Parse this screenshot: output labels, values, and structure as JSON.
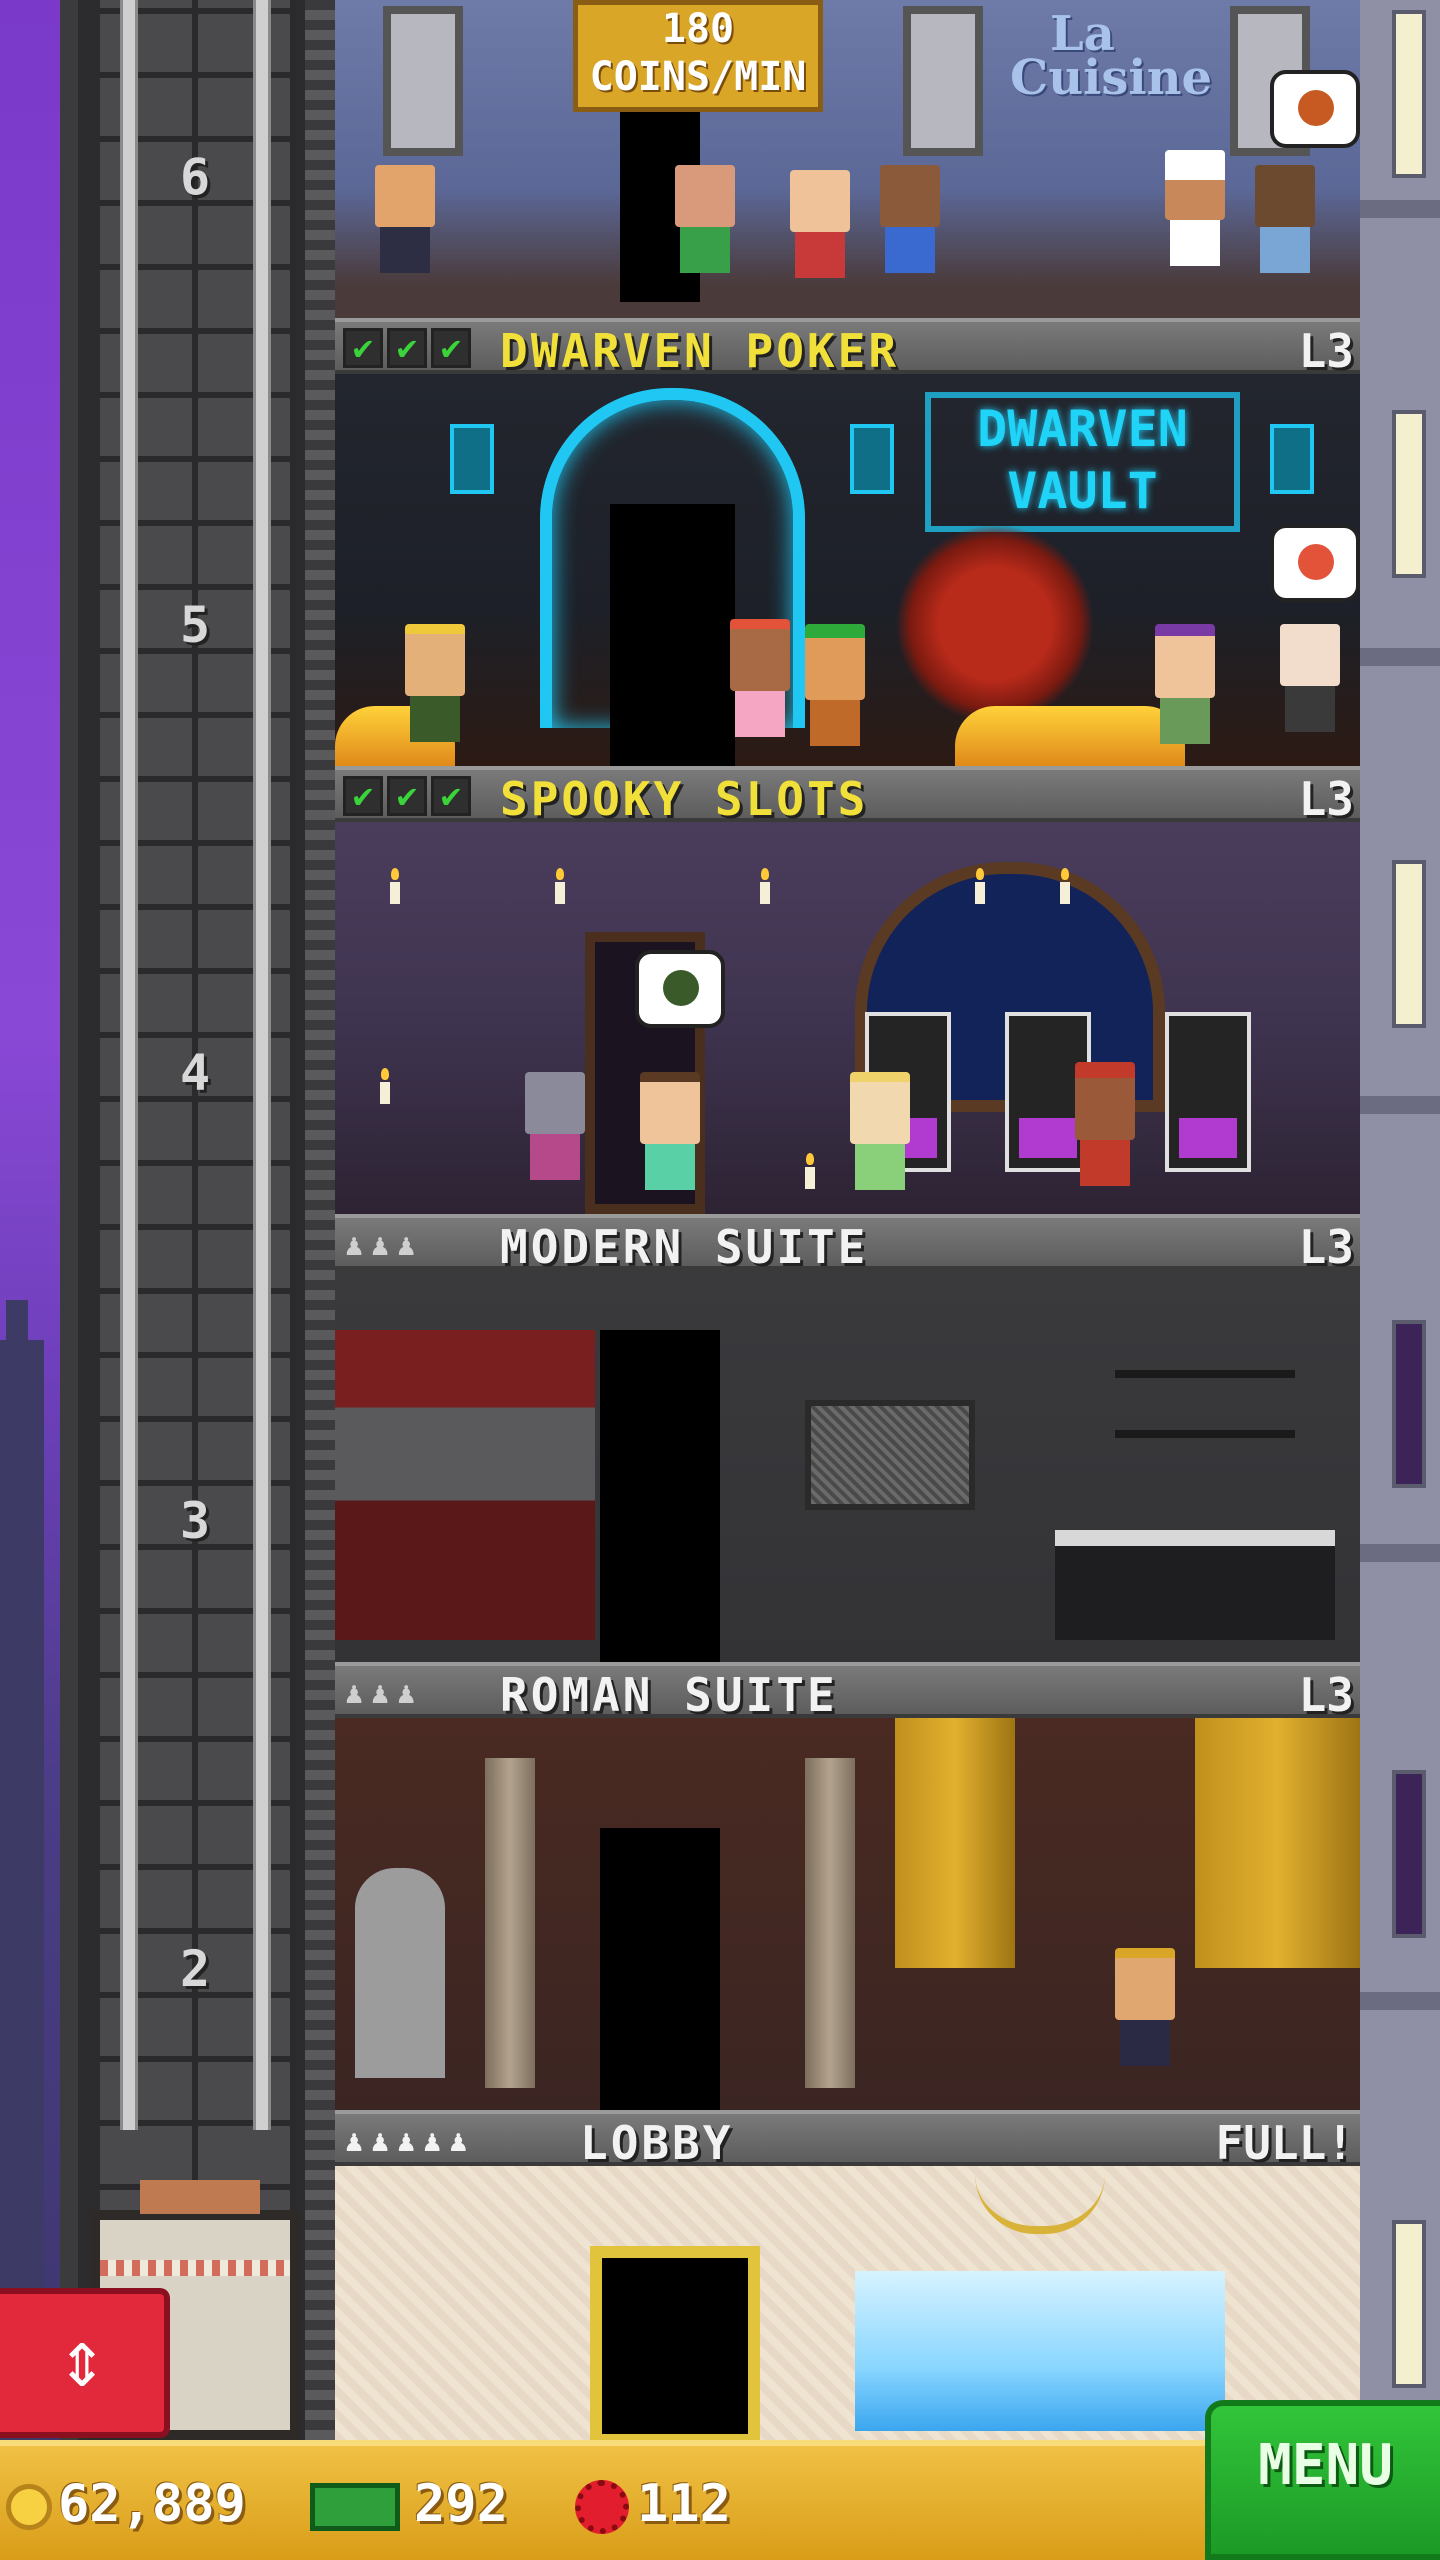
{
  "floor_numbers": [
    "6",
    "5",
    "4",
    "3",
    "2"
  ],
  "floors": {
    "restaurant": {
      "coins_rate_line1": "180",
      "coins_rate_line2": "COINS/MIN",
      "sign_line1": "La",
      "sign_line2": "Cuisine"
    },
    "dwarven_poker": {
      "name": "DWARVEN POKER",
      "level": "L3",
      "checks": [
        "✔",
        "✔",
        "✔"
      ],
      "vault_line1": "DWARVEN",
      "vault_line2": "VAULT"
    },
    "spooky_slots": {
      "name": "SPOOKY SLOTS",
      "level": "L3",
      "checks": [
        "✔",
        "✔",
        "✔"
      ]
    },
    "modern_suite": {
      "name": "MODERN SUITE",
      "level": "L3",
      "residents": "♟♟♟"
    },
    "roman_suite": {
      "name": "ROMAN SUITE",
      "level": "L3",
      "residents": "♟♟♟"
    },
    "lobby": {
      "name": "LOBBY",
      "status": "FULL!",
      "residents": "♟♟♟♟♟"
    }
  },
  "elevator_button": {
    "icon": "up-down-arrows-icon",
    "glyph": "⇕"
  },
  "bottom_bar": {
    "coins": "62,889",
    "cash": "292",
    "bux": "112",
    "menu_label": "MENU"
  },
  "colors": {
    "floor_name_active": "#f1e03a",
    "floor_name_inactive": "#f2f2f2",
    "check_green": "#3ad43a",
    "menu_green": "#1c9a26",
    "elevator_button_red": "#e2283b",
    "bottom_bar_gold": "#d99d18"
  }
}
